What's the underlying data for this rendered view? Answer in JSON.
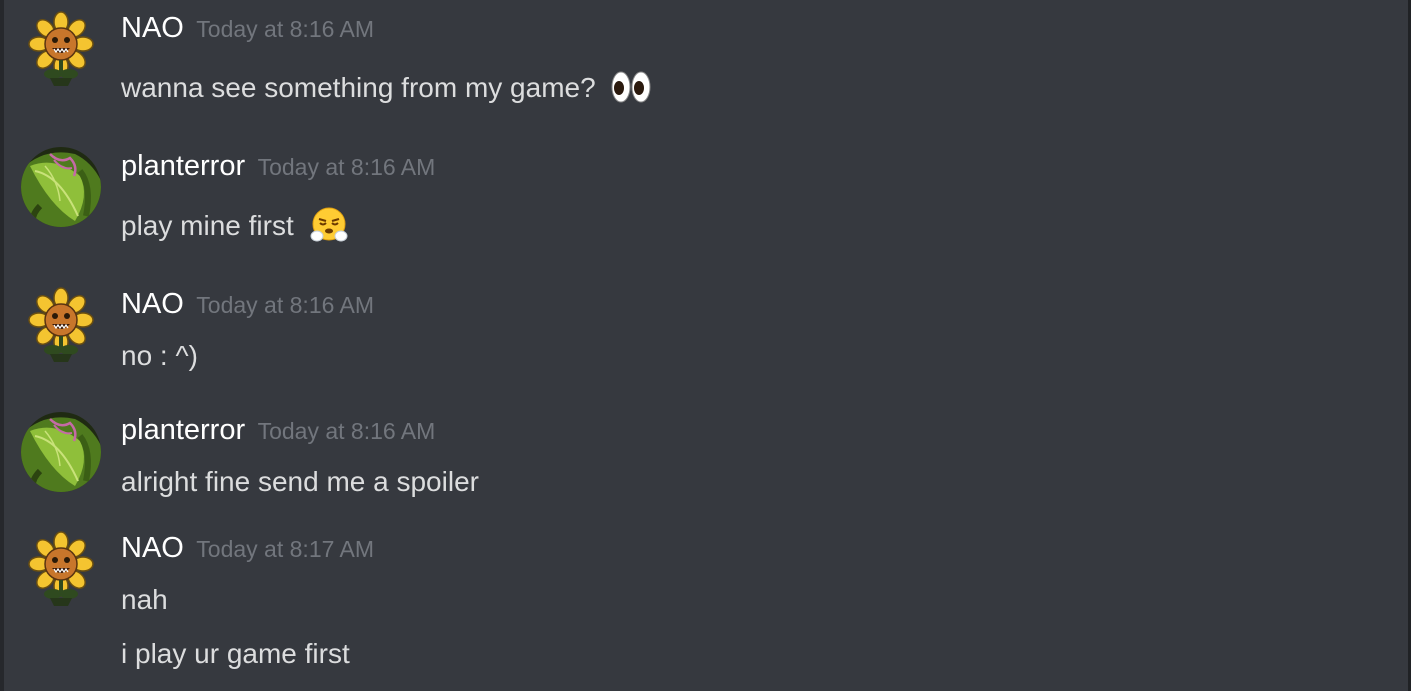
{
  "messages": [
    {
      "author": "NAO",
      "timestamp": "Today at 8:16 AM",
      "avatar_icon": "sunflower-avatar-icon",
      "lines": [
        "wanna see something from my game?"
      ],
      "emoji": "eyes-emoji"
    },
    {
      "author": "planterror",
      "timestamp": "Today at 8:16 AM",
      "avatar_icon": "plant-avatar-icon",
      "lines": [
        "play mine first"
      ],
      "emoji": "steam-face-emoji"
    },
    {
      "author": "NAO",
      "timestamp": "Today at 8:16 AM",
      "avatar_icon": "sunflower-avatar-icon",
      "lines": [
        "no : ^)"
      ]
    },
    {
      "author": "planterror",
      "timestamp": "Today at 8:16 AM",
      "avatar_icon": "plant-avatar-icon",
      "lines": [
        "alright fine send me a spoiler"
      ]
    },
    {
      "author": "NAO",
      "timestamp": "Today at 8:17 AM",
      "avatar_icon": "sunflower-avatar-icon",
      "lines": [
        "nah",
        "i play ur game first"
      ]
    }
  ],
  "colors": {
    "background": "#36393f",
    "username": "#ffffff",
    "timestamp": "#72767d",
    "message_text": "#dcddde"
  }
}
